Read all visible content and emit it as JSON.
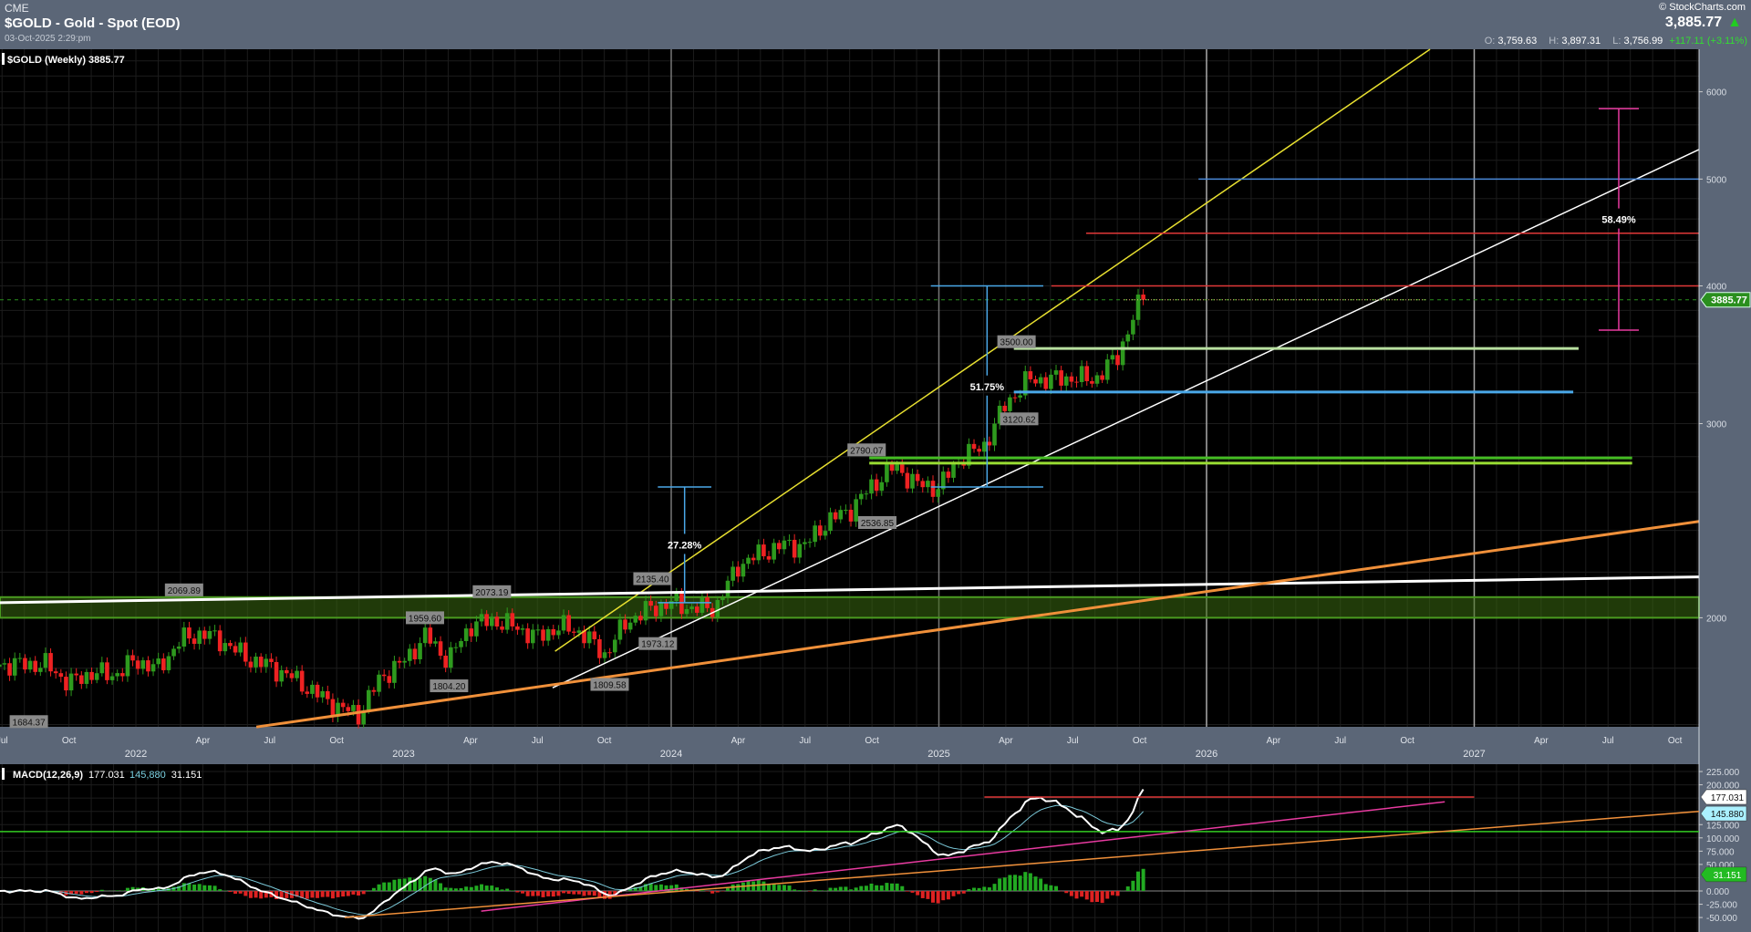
{
  "header": {
    "exchange": "CME",
    "title": "$GOLD - Gold - Spot (EOD)",
    "datetime": "03-Oct-2025 2:29:pm",
    "brand": "© StockCharts.com",
    "last": "3,885.77",
    "open_label": "O:",
    "open": "3,759.63",
    "high_label": "H:",
    "high": "3,897.31",
    "low_label": "L:",
    "low": "3,756.99",
    "change": "+117.11 (+3.11%)"
  },
  "colors": {
    "up": "#2e9a1e",
    "down": "#ee2222",
    "bg": "#000000",
    "panel": "#5b6677",
    "accent_green": "#2a8f1e"
  },
  "chart_data": [
    {
      "type": "candlestick",
      "title": "$GOLD (Weekly) 3885.77",
      "scale": "log",
      "ylim": [
        1550,
        6600
      ],
      "xlim": [
        2021.49,
        2027.84
      ],
      "y_ticks": [
        "2000",
        "3000",
        "4000",
        "5000",
        "6000"
      ],
      "y_tick_values": [
        2000,
        3000,
        4000,
        5000,
        6000
      ],
      "x_month_labels": [
        "Jul",
        "Oct",
        "Apr",
        "Jul",
        "Oct",
        "Apr",
        "Jul",
        "Oct",
        "Apr",
        "Jul",
        "Oct",
        "Apr",
        "Jul",
        "Oct",
        "Apr",
        "Jul",
        "Oct",
        "Apr",
        "Jul",
        "Oct"
      ],
      "x_month_values": [
        2021.5,
        2021.75,
        2022.25,
        2022.5,
        2022.75,
        2023.25,
        2023.5,
        2023.75,
        2024.25,
        2024.5,
        2024.75,
        2025.25,
        2025.5,
        2025.75,
        2026.25,
        2026.5,
        2026.75,
        2027.25,
        2027.5,
        2027.75
      ],
      "x_year_labels": [
        "2022",
        "2023",
        "2024",
        "2025",
        "2026",
        "2027"
      ],
      "x_year_values": [
        2022,
        2023,
        2024,
        2025,
        2026,
        2027
      ],
      "monthly_start": 2021.5,
      "monthly_closes": [
        1814,
        1813,
        1743,
        1783,
        1774,
        1829,
        1797,
        1909,
        1937,
        1897,
        1837,
        1807,
        1766,
        1711,
        1661,
        1633,
        1768,
        1824,
        1928,
        1827,
        1969,
        1990,
        1963,
        1919,
        1965,
        1940,
        1849,
        1983,
        2036,
        2063,
        2039,
        2044,
        2230,
        2286,
        2327,
        2326,
        2447,
        2503,
        2634,
        2744,
        2643,
        2625,
        2798,
        2858,
        3124,
        3289,
        3289,
        3303,
        3290,
        3448,
        3858
      ],
      "last_close": 3885.77,
      "last_label": "3885.77",
      "price_labels": [
        {
          "text": "1684.37",
          "t": 2021.6,
          "p": 1610
        },
        {
          "text": "2069.89",
          "t": 2022.18,
          "p": 2120
        },
        {
          "text": "1959.60",
          "t": 2023.08,
          "p": 2000
        },
        {
          "text": "2073.19",
          "t": 2023.33,
          "p": 2112
        },
        {
          "text": "1804.20",
          "t": 2023.17,
          "p": 1735
        },
        {
          "text": "2135.40",
          "t": 2023.93,
          "p": 2170
        },
        {
          "text": "1973.12",
          "t": 2023.95,
          "p": 1895
        },
        {
          "text": "1809.58",
          "t": 2023.77,
          "p": 1740
        },
        {
          "text": "2790.07",
          "t": 2024.73,
          "p": 2840
        },
        {
          "text": "2536.85",
          "t": 2024.77,
          "p": 2440
        },
        {
          "text": "3500.00",
          "t": 2025.29,
          "p": 3560
        },
        {
          "text": "3120.62",
          "t": 2025.3,
          "p": 3030
        }
      ],
      "lines": [
        {
          "name": "yellow-trendline",
          "color": "#e8e030",
          "w": 1.5,
          "t1": 2023.566,
          "p1": 1865,
          "t2": 2026.835,
          "p2": 6557
        },
        {
          "name": "white-trendline",
          "color": "#ffffff",
          "w": 1.5,
          "t1": 2023.557,
          "p1": 1728,
          "t2": 2027.84,
          "p2": 5318
        },
        {
          "name": "white-resistance-line",
          "color": "#ffffff",
          "w": 3,
          "t1": 2021.49,
          "p1": 2064,
          "t2": 2027.84,
          "p2": 2178
        },
        {
          "name": "orange-support-line",
          "color": "#f0903a",
          "w": 3,
          "t1": 2022.45,
          "p1": 1592,
          "t2": 2027.84,
          "p2": 2446
        },
        {
          "name": "blue-target-5000",
          "color": "#4a88d8",
          "w": 1.5,
          "t1": 2025.97,
          "p1": 5000,
          "t2": 2027.84,
          "p2": 5000
        },
        {
          "name": "red-target-4465",
          "color": "#e03838",
          "w": 1.5,
          "t1": 2025.55,
          "p1": 4465,
          "t2": 2027.84,
          "p2": 4465
        },
        {
          "name": "red-target-4000",
          "color": "#e03838",
          "w": 1.5,
          "t1": 2025.42,
          "p1": 4000,
          "t2": 2027.84,
          "p2": 4000
        },
        {
          "name": "light-green-3500",
          "color": "#b8e0a0",
          "w": 3,
          "t1": 2025.28,
          "p1": 3510,
          "t2": 2027.39,
          "p2": 3510
        },
        {
          "name": "blue-support-3205",
          "color": "#4aa8e8",
          "w": 3,
          "t1": 2025.28,
          "p1": 3205,
          "t2": 2027.37,
          "p2": 3205
        },
        {
          "name": "green-support-2793",
          "color": "#44bb22",
          "w": 3,
          "t1": 2024.74,
          "p1": 2793,
          "t2": 2027.59,
          "p2": 2793
        },
        {
          "name": "green-support-2762",
          "color": "#99dd33",
          "w": 3,
          "t1": 2024.74,
          "p1": 2762,
          "t2": 2027.59,
          "p2": 2762
        }
      ],
      "zone": {
        "p1": 2000,
        "p2": 2088,
        "color": "#3a6a10"
      },
      "measures": [
        {
          "label": "27.28%",
          "color": "#4aa8e8",
          "t": 2024.05,
          "tw": 0.1,
          "p1": 2064,
          "p2": 2628
        },
        {
          "label": "51.75%",
          "color": "#4aa8e8",
          "t": 2025.18,
          "tw": 0.21,
          "p1": 2628,
          "p2": 4000
        },
        {
          "label": "58.49%",
          "color": "#e83aa0",
          "t": 2027.54,
          "tw": 0.075,
          "p1": 3647,
          "p2": 5792
        }
      ]
    },
    {
      "type": "macd",
      "label": "MACD(12,26,9)",
      "macd_value": "177.031",
      "signal_value": "145,880",
      "hist_value": "31.151",
      "macd_tag": "177.031",
      "signal_tag": "145.880",
      "hist_tag": "31.151",
      "ylim": [
        -62,
        240
      ],
      "y_ticks": [
        "225.000",
        "200.000",
        "125.000",
        "100.000",
        "75.000",
        "50.000",
        "0.000",
        "-25.000",
        "-50.000"
      ],
      "y_tick_values": [
        225,
        200,
        125,
        100,
        75,
        50,
        0,
        -25,
        -50
      ],
      "lines": [
        {
          "name": "green-level",
          "color": "#33cc22",
          "w": 1.5,
          "t1": 2021.49,
          "v1": 112,
          "t2": 2027.84,
          "v2": 112
        },
        {
          "name": "red-level",
          "color": "#e03838",
          "w": 1.5,
          "t1": 2025.17,
          "v1": 177,
          "t2": 2027.0,
          "v2": 177
        },
        {
          "name": "pink-trendline",
          "color": "#e83aa0",
          "w": 1.5,
          "t1": 2023.29,
          "v1": -38,
          "t2": 2026.89,
          "v2": 168
        },
        {
          "name": "orange-trendline",
          "color": "#f0903a",
          "w": 1.5,
          "t1": 2022.78,
          "v1": -50,
          "t2": 2027.84,
          "v2": 150
        }
      ]
    }
  ]
}
